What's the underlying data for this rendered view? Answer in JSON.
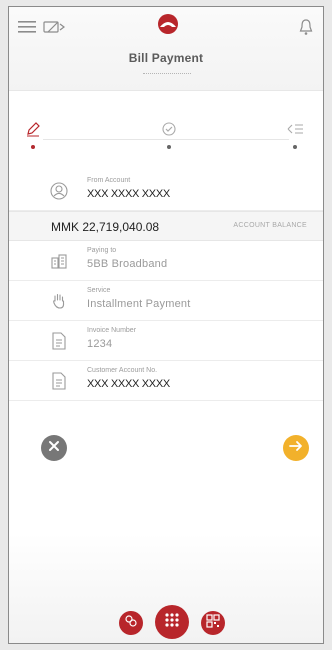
{
  "header": {
    "title": "Bill Payment",
    "icons": [
      "menu-icon",
      "switch-account-icon",
      "bank-logo",
      "bell-icon"
    ]
  },
  "steps": {
    "icons": [
      "edit-icon",
      "verify-icon",
      "confirm-icon"
    ],
    "active_index": 0
  },
  "form": {
    "from_account": {
      "label": "From Account",
      "value": "XXX XXXX XXXX"
    },
    "balance": {
      "amount": "MMK 22,719,040.08",
      "label": "ACCOUNT BALANCE"
    },
    "paying_to": {
      "label": "Paying to",
      "value": "5BB Broadband"
    },
    "service": {
      "label": "Service",
      "value": "Installment Payment"
    },
    "invoice_number": {
      "label": "Invoice Number",
      "value": "1234"
    },
    "customer_account": {
      "label": "Customer Account No.",
      "value": "XXX XXXX XXXX"
    }
  },
  "colors": {
    "brand": "#b8262b",
    "next": "#f2b12b",
    "cancel": "#777777"
  }
}
